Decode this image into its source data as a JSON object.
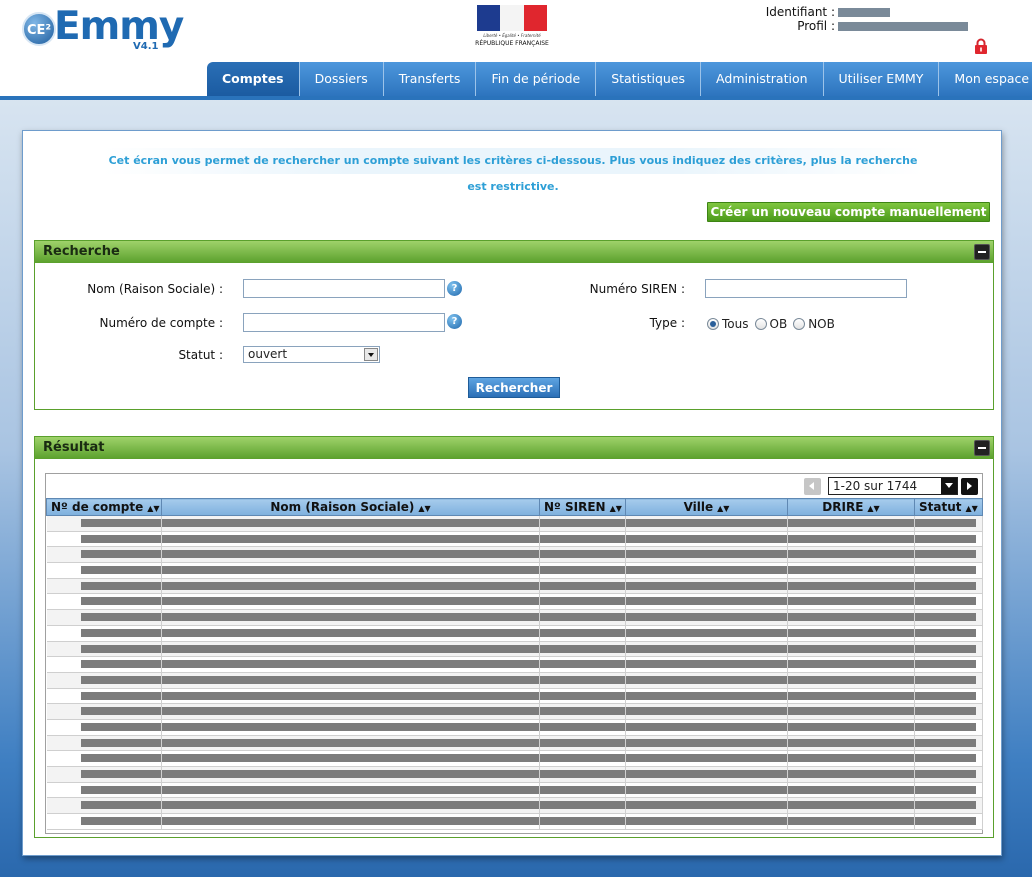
{
  "app": {
    "logo_prefix": "CE²",
    "logo_name": "Emmy",
    "version": "V4.1",
    "republic_motto": "Liberté • Égalité • Fraternité",
    "republic_name": "RÉPUBLIQUE FRANÇAISE"
  },
  "user": {
    "identifiant_label": "Identifiant :",
    "profil_label": "Profil :"
  },
  "tabs": [
    {
      "label": "Comptes",
      "active": true
    },
    {
      "label": "Dossiers"
    },
    {
      "label": "Transferts"
    },
    {
      "label": "Fin de période"
    },
    {
      "label": "Statistiques"
    },
    {
      "label": "Administration"
    },
    {
      "label": "Utiliser EMMY"
    },
    {
      "label": "Mon espace"
    }
  ],
  "info_text": "Cet écran vous permet de rechercher un compte suivant les critères ci-dessous. Plus vous indiquez des critères, plus la recherche est restrictive.",
  "create_button": "Créer un nouveau compte manuellement",
  "search": {
    "title": "Recherche",
    "nom_label": "Nom (Raison Sociale) :",
    "nom_value": "",
    "compte_label": "Numéro de compte :",
    "compte_value": "",
    "statut_label": "Statut :",
    "statut_value": "ouvert",
    "siren_label": "Numéro SIREN :",
    "siren_value": "",
    "type_label": "Type :",
    "type_options": [
      "Tous",
      "OB",
      "NOB"
    ],
    "type_selected": "Tous",
    "submit": "Rechercher",
    "help_glyph": "?"
  },
  "results": {
    "title": "Résultat",
    "pagination": "1-20 sur 1744",
    "columns": [
      "Nº de compte",
      "Nom (Raison Sociale)",
      "Nº SIREN",
      "Ville",
      "DRIRE",
      "Statut"
    ],
    "row_count": 20
  },
  "colors": {
    "accent_blue": "#2a73bb",
    "tab_blue": "#3d86cf",
    "green": "#5aa02c",
    "info_cyan": "#2d9fd6"
  }
}
